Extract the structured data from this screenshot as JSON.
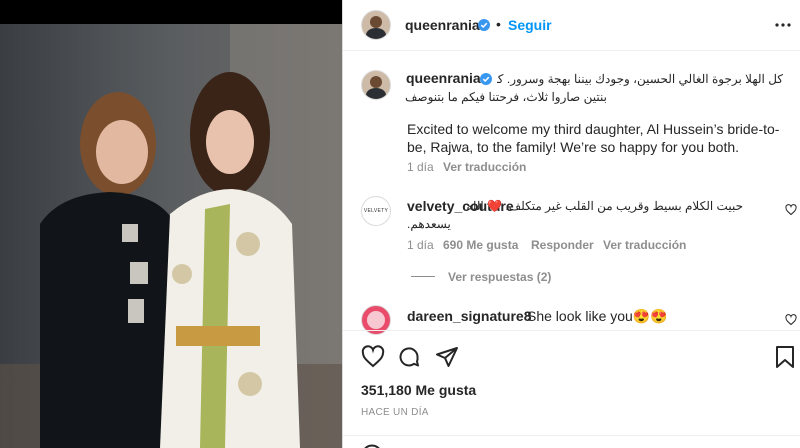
{
  "post": {
    "header": {
      "username": "queenrania",
      "follow_label": "Seguir",
      "more_icon": "more-horizontal-icon"
    },
    "caption": {
      "username": "queenrania",
      "arabic_line1": "كل الهلا برجوة الغالي الحسين، وجودك بيننا بهجة وسرور. كان عندي",
      "arabic_line2": "بنتين صاروا ثلاث، فرحتنا فيكم ما بتنوصف",
      "english": "Excited to welcome my third daughter, Al Hussein’s bride-to-be, Rajwa, to the family! We’re so happy for you both.",
      "time": "1 día",
      "see_translation": "Ver traducción"
    },
    "comments": [
      {
        "username": "velvety_couture",
        "text_line1": "حبيت الكلام بسيط وقريب من القلب غير متكلف. ❤️ الله",
        "text_line2": "يسعدهم.",
        "time": "1 día",
        "likes": "690 Me gusta",
        "reply": "Responder",
        "see_translation": "Ver traducción",
        "view_replies": "Ver respuestas (2)",
        "avatar_text": "VELVETY"
      },
      {
        "username": "dareen_signature8",
        "text": "She look like you😍😍"
      }
    ],
    "likes_count": "351,180 Me gusta",
    "timestamp": "HACE UN DÍA"
  },
  "colors": {
    "accent": "#0095f6",
    "text": "#262626",
    "secondary": "#8e8e8e",
    "verified": "#3897f0"
  }
}
